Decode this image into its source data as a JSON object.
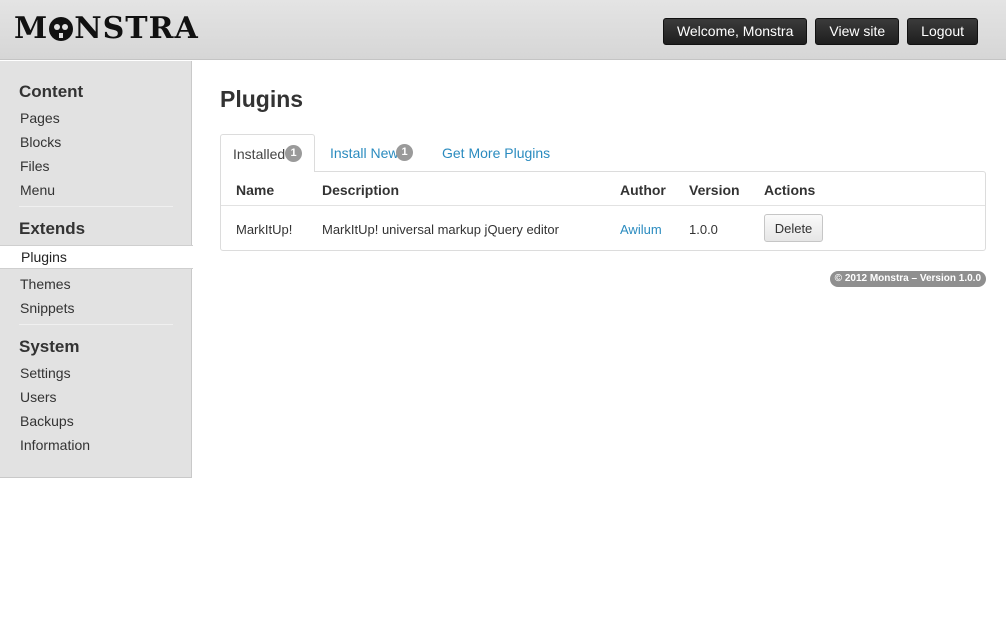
{
  "header": {
    "logo": "MONSTRA",
    "welcome": "Welcome, Monstra",
    "view_site": "View site",
    "logout": "Logout"
  },
  "sidebar": {
    "sections": [
      {
        "heading": "Content",
        "items": [
          "Pages",
          "Blocks",
          "Files",
          "Menu"
        ]
      },
      {
        "heading": "Extends",
        "items": [
          "Plugins",
          "Themes",
          "Snippets"
        ]
      },
      {
        "heading": "System",
        "items": [
          "Settings",
          "Users",
          "Backups",
          "Information"
        ]
      }
    ],
    "active_item": "Plugins"
  },
  "main": {
    "title": "Plugins",
    "tabs": [
      {
        "label": "Installed",
        "badge": "1"
      },
      {
        "label": "Install New",
        "badge": "1"
      },
      {
        "label": "Get More Plugins"
      }
    ],
    "table": {
      "columns": [
        "Name",
        "Description",
        "Author",
        "Version",
        "Actions"
      ],
      "rows": [
        {
          "name": "MarkItUp!",
          "description": "MarkItUp! universal markup jQuery editor",
          "author": "Awilum",
          "version": "1.0.0",
          "action": "Delete"
        }
      ]
    }
  },
  "footer": {
    "text": "© 2012 Monstra – Version 1.0.0"
  },
  "colors": {
    "link": "#2a8bbf",
    "header_bg": "#dcdcdc",
    "sidebar_bg": "#e2e2e2",
    "button_dark": "#2a2a2a"
  }
}
